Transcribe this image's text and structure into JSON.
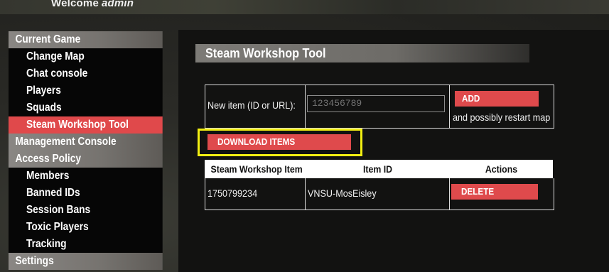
{
  "header": {
    "welcome_text": "Welcome",
    "username": "admin"
  },
  "sidebar": {
    "items": [
      {
        "label": "Current Game",
        "type": "section",
        "active": false
      },
      {
        "label": "Change Map",
        "type": "sub",
        "active": false
      },
      {
        "label": "Chat console",
        "type": "sub",
        "active": false
      },
      {
        "label": "Players",
        "type": "sub",
        "active": false
      },
      {
        "label": "Squads",
        "type": "sub",
        "active": false
      },
      {
        "label": "Steam Workshop Tool",
        "type": "sub",
        "active": true
      },
      {
        "label": "Management Console",
        "type": "section",
        "active": false
      },
      {
        "label": "Access Policy",
        "type": "section",
        "active": false
      },
      {
        "label": "Members",
        "type": "sub",
        "active": false
      },
      {
        "label": "Banned IDs",
        "type": "sub",
        "active": false
      },
      {
        "label": "Session Bans",
        "type": "sub",
        "active": false
      },
      {
        "label": "Toxic Players",
        "type": "sub",
        "active": false
      },
      {
        "label": "Tracking",
        "type": "sub",
        "active": false
      },
      {
        "label": "Settings",
        "type": "section",
        "active": false
      }
    ]
  },
  "main": {
    "title": "Steam Workshop Tool",
    "new_item": {
      "label": "New item (ID or URL):",
      "placeholder": "123456789",
      "value": "",
      "add_label": "ADD",
      "add_note": "and possibly restart map"
    },
    "download_label": "DOWNLOAD ITEMS",
    "table": {
      "headers": [
        "Steam Workshop Item",
        "Item ID",
        "Actions"
      ],
      "rows": [
        {
          "workshop_item": "1750799234",
          "item_id": "VNSU-MosEisley",
          "action_label": "DELETE"
        }
      ]
    }
  },
  "colors": {
    "accent_red": "#df4a4c",
    "highlight_yellow": "#f2ef12"
  }
}
